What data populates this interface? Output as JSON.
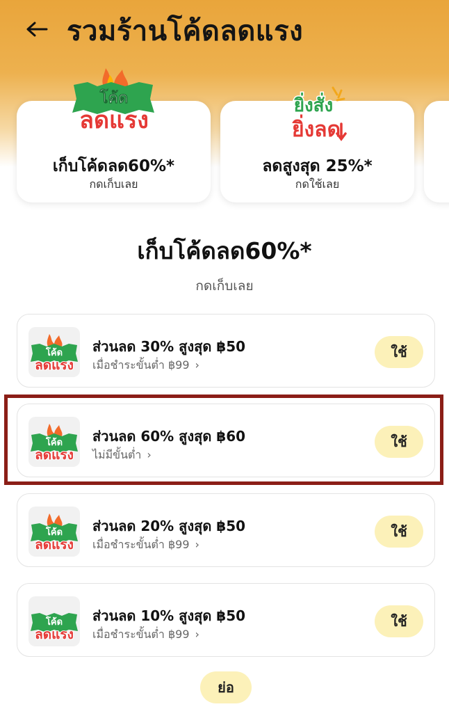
{
  "header": {
    "title": "รวมร้านโค้ดลดแรง",
    "back_icon": "arrow-left-icon"
  },
  "colors": {
    "header_orange": "#E9A53B",
    "use_button_bg": "#FCF1B9",
    "highlight_border": "#8B1E17",
    "logo_green": "#2EA44F",
    "logo_red": "#E53935"
  },
  "logo": {
    "top": "โค้ด",
    "bottom": "ลดแรง"
  },
  "logo2": {
    "top": "ยิ่งสั่ง",
    "bottom": "ยิ่งลด"
  },
  "promo_cards": [
    {
      "title": "เก็บโค้ดลด60%*",
      "subtitle": "กดเก็บเลย"
    },
    {
      "title": "ลดสูงสุด 25%*",
      "subtitle": "กดใช้เลย"
    }
  ],
  "section": {
    "title": "เก็บโค้ดลด60%*",
    "subtitle": "กดเก็บเลย"
  },
  "vouchers": [
    {
      "title": "ส่วนลด 30% สูงสุด ฿50",
      "condition": "เมื่อชำระขั้นต่ำ ฿99",
      "button": "ใช้"
    },
    {
      "title": "ส่วนลด 60% สูงสุด ฿60",
      "condition": "ไม่มีขั้นต่ำ",
      "button": "ใช้"
    },
    {
      "title": "ส่วนลด 20% สูงสุด ฿50",
      "condition": "เมื่อชำระขั้นต่ำ ฿99",
      "button": "ใช้"
    },
    {
      "title": "ส่วนลด 10% สูงสุด ฿50",
      "condition": "เมื่อชำระขั้นต่ำ ฿99",
      "button": "ใช้"
    }
  ],
  "collapse_label": "ย่อ",
  "chevron": "›"
}
